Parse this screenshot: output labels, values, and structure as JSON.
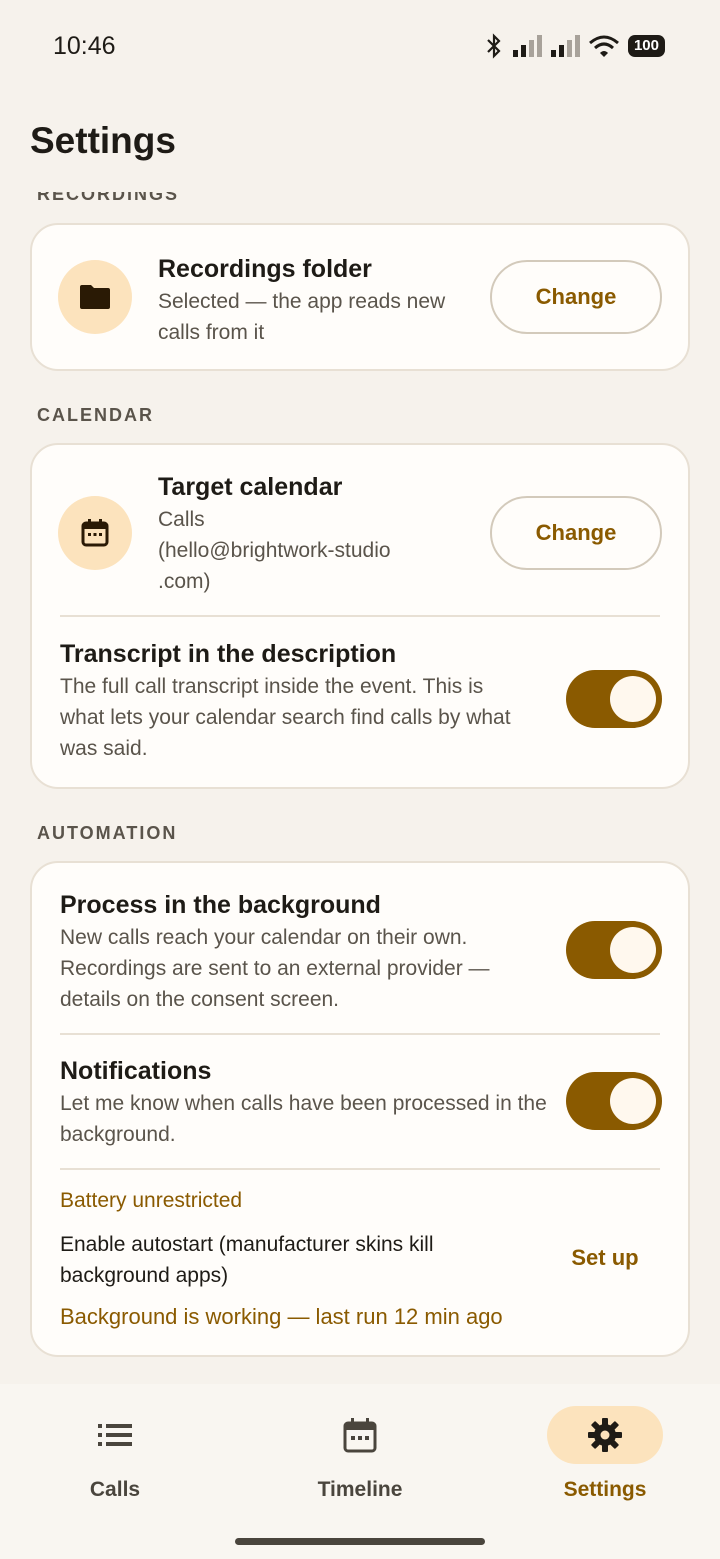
{
  "status": {
    "time": "10:46",
    "battery": "100"
  },
  "page": {
    "title": "Settings"
  },
  "sections": {
    "recordings_clipped": "RECORDINGS",
    "calendar": "CALENDAR",
    "automation": "AUTOMATION"
  },
  "recordings": {
    "folder_title": "Recordings folder",
    "folder_sub": "Selected — the app reads new calls from it",
    "change_label": "Change"
  },
  "calendar": {
    "target_title": "Target calendar",
    "target_sub_1": "Calls",
    "target_sub_2": "(hello@brightwork-studio",
    "target_sub_3": ".com)",
    "change_label": "Change",
    "transcript_title": "Transcript in the description",
    "transcript_sub": "The full call transcript inside the event. This is what lets your calendar search find calls by what was said.",
    "transcript_on": true
  },
  "automation": {
    "background_title": "Process in the background",
    "background_sub": "New calls reach your calendar on their own. Recordings are sent to an external provider — details on the consent screen.",
    "background_on": true,
    "notifications_title": "Notifications",
    "notifications_sub": "Let me know when calls have been processed in the background.",
    "notifications_on": true,
    "battery_status": "Battery unrestricted",
    "autostart_text": "Enable autostart (manufacturer skins kill background apps)",
    "setup_label": "Set up",
    "background_status": "Background is working — last run 12 min ago"
  },
  "nav": {
    "items": [
      {
        "label": "Calls",
        "icon": "list-icon"
      },
      {
        "label": "Timeline",
        "icon": "calendar-icon"
      },
      {
        "label": "Settings",
        "icon": "gear-icon",
        "active": true
      }
    ]
  },
  "colors": {
    "accent": "#8a5a00",
    "accent_container": "#fce3bd",
    "background": "#f6f2ec"
  }
}
